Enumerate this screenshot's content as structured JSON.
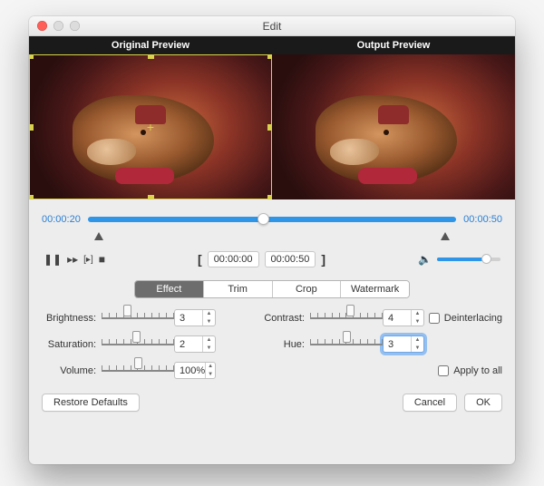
{
  "window": {
    "title": "Edit"
  },
  "preview": {
    "original_label": "Original Preview",
    "output_label": "Output Preview"
  },
  "timeline": {
    "start_time": "00:00:20",
    "end_time": "00:00:50",
    "playhead_pct": 46
  },
  "bracket": {
    "in_time": "00:00:00",
    "out_time": "00:00:50"
  },
  "volume_slider_pct": 78,
  "tabs": {
    "items": [
      "Effect",
      "Trim",
      "Crop",
      "Watermark"
    ],
    "active_index": 0
  },
  "effect": {
    "brightness": {
      "label": "Brightness:",
      "value": "3",
      "knob_pct": 35
    },
    "contrast": {
      "label": "Contrast:",
      "value": "4",
      "knob_pct": 55
    },
    "saturation": {
      "label": "Saturation:",
      "value": "2",
      "knob_pct": 48
    },
    "hue": {
      "label": "Hue:",
      "value": "3",
      "knob_pct": 50
    },
    "volume": {
      "label": "Volume:",
      "value": "100%",
      "knob_pct": 50
    }
  },
  "checks": {
    "deinterlacing_label": "Deinterlacing",
    "apply_label": "Apply to all"
  },
  "footer": {
    "restore": "Restore Defaults",
    "cancel": "Cancel",
    "ok": "OK"
  }
}
